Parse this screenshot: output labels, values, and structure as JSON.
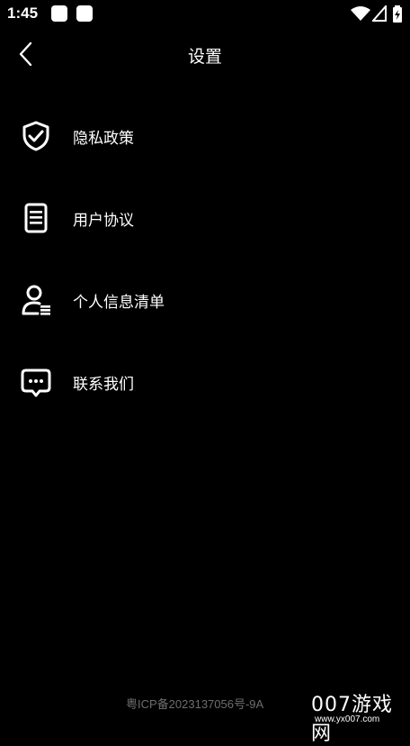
{
  "status_bar": {
    "time": "1:45"
  },
  "header": {
    "title": "设置"
  },
  "menu": [
    {
      "label": "隐私政策",
      "icon": "shield-check-icon"
    },
    {
      "label": "用户协议",
      "icon": "document-icon"
    },
    {
      "label": "个人信息清单",
      "icon": "person-list-icon"
    },
    {
      "label": "联系我们",
      "icon": "chat-bubble-icon"
    }
  ],
  "footer": {
    "icp": "粤ICP备2023137056号-9A"
  },
  "watermark": {
    "brand": "007游戏网",
    "url": "www.yx007.com"
  }
}
